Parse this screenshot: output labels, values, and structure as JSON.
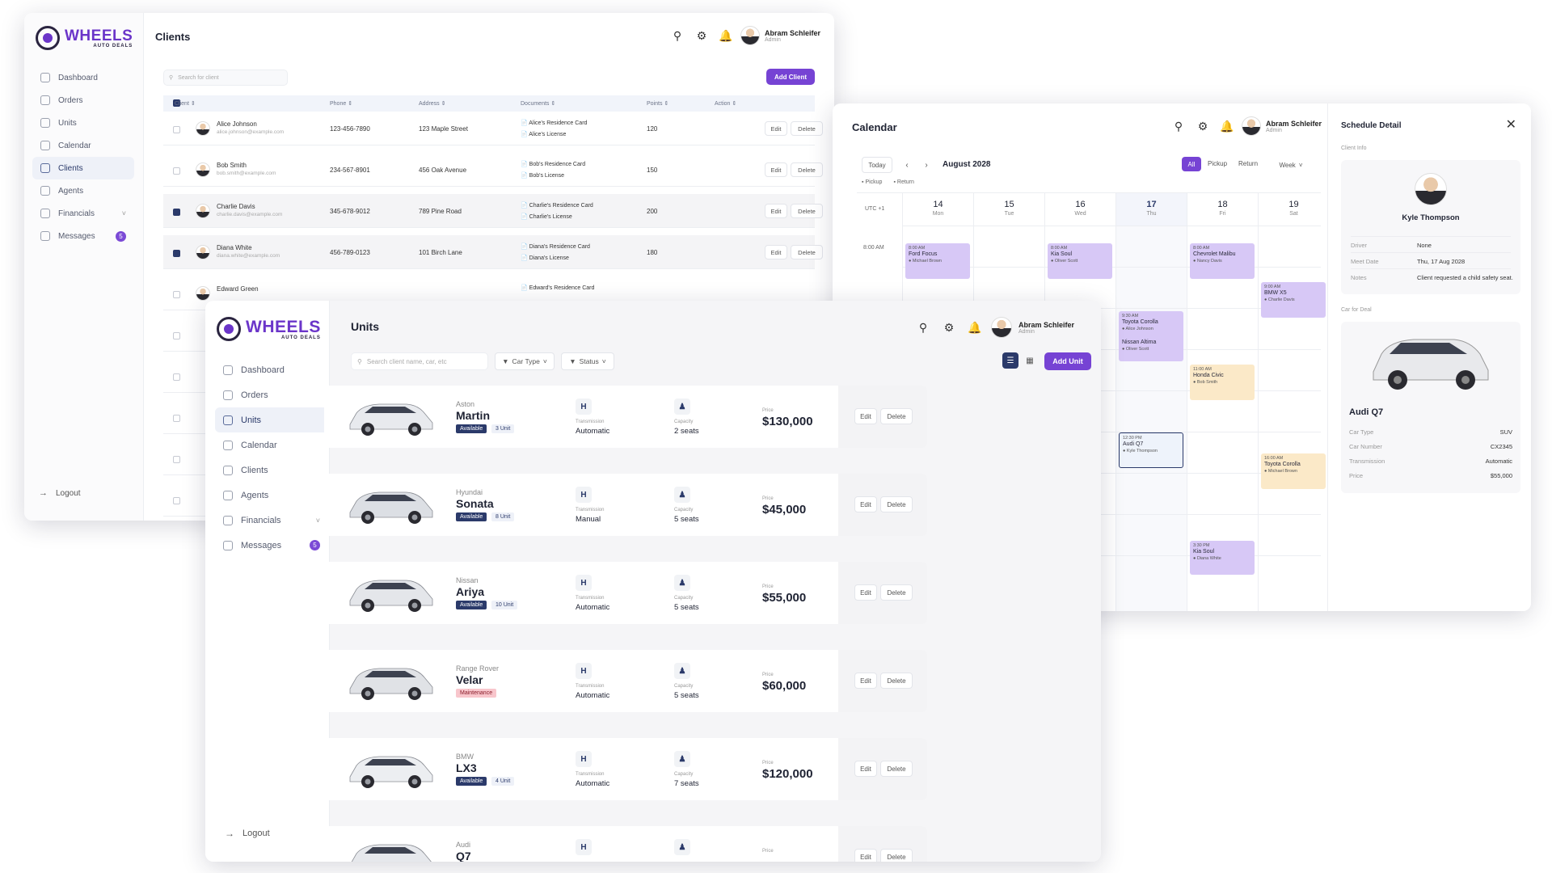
{
  "brand": {
    "name": "WHEELS",
    "tagline": "AUTO DEALS"
  },
  "user": {
    "name": "Abram Schleifer",
    "role": "Admin"
  },
  "nav": [
    {
      "label": "Dashboard",
      "icon": "dashboard-icon"
    },
    {
      "label": "Orders",
      "icon": "orders-icon"
    },
    {
      "label": "Units",
      "icon": "car-icon"
    },
    {
      "label": "Calendar",
      "icon": "calendar-icon"
    },
    {
      "label": "Clients",
      "icon": "clients-icon"
    },
    {
      "label": "Agents",
      "icon": "agents-icon"
    },
    {
      "label": "Financials",
      "icon": "financials-icon"
    },
    {
      "label": "Messages",
      "icon": "messages-icon",
      "badge": "5"
    }
  ],
  "logout": "Logout",
  "clients": {
    "title": "Clients",
    "search_placeholder": "Search for client",
    "add_button": "Add Client",
    "columns": [
      "Client",
      "Phone",
      "Address",
      "Documents",
      "Points",
      "Action"
    ],
    "rows": [
      {
        "name": "Alice Johnson",
        "email": "alice.johnson@example.com",
        "phone": "123-456-7890",
        "address": "123 Maple Street",
        "doc1": "Alice's Residence Card",
        "doc2": "Alice's License",
        "points": "120",
        "checked": false
      },
      {
        "name": "Bob Smith",
        "email": "bob.smith@example.com",
        "phone": "234-567-8901",
        "address": "456 Oak Avenue",
        "doc1": "Bob's Residence Card",
        "doc2": "Bob's License",
        "points": "150",
        "checked": false
      },
      {
        "name": "Charlie Davis",
        "email": "charlie.davis@example.com",
        "phone": "345-678-9012",
        "address": "789 Pine Road",
        "doc1": "Charlie's Residence Card",
        "doc2": "Charlie's License",
        "points": "200",
        "checked": true
      },
      {
        "name": "Diana White",
        "email": "diana.white@example.com",
        "phone": "456-789-0123",
        "address": "101 Birch Lane",
        "doc1": "Diana's Residence Card",
        "doc2": "Diana's License",
        "points": "180",
        "checked": true
      },
      {
        "name": "Edward Green",
        "email": "",
        "phone": "",
        "address": "",
        "doc1": "Edward's Residence Card",
        "doc2": "",
        "points": "",
        "checked": false
      }
    ],
    "edit": "Edit",
    "delete": "Delete"
  },
  "calendar": {
    "title": "Calendar",
    "today": "Today",
    "month": "August 2028",
    "filters": [
      "All",
      "Pickup",
      "Return"
    ],
    "view": "Week",
    "legend": [
      "Pickup",
      "Return"
    ],
    "tz": "UTC +1",
    "time_label": "8:00 AM",
    "days": [
      {
        "num": "14",
        "name": "Mon"
      },
      {
        "num": "15",
        "name": "Tue"
      },
      {
        "num": "16",
        "name": "Wed"
      },
      {
        "num": "17",
        "name": "Thu"
      },
      {
        "num": "18",
        "name": "Fri"
      },
      {
        "num": "19",
        "name": "Sat"
      }
    ],
    "events": [
      {
        "time": "8:00 AM",
        "car": "Ford Focus",
        "who": "Michael Brown"
      },
      {
        "time": "8:00 AM",
        "car": "Kia Soul",
        "who": "Oliver Scott"
      },
      {
        "time": "8:00 AM",
        "car": "Chevrolet Malibu",
        "who": "Nancy Davis"
      },
      {
        "time": "9:00 AM",
        "car": "BMW X5",
        "who": "Charlie Davis"
      },
      {
        "time": "9:30 AM",
        "car": "Toyota Corolla",
        "who": "Alice Johnson"
      },
      {
        "time": "",
        "car": "Nissan Altima",
        "who": "Oliver Scott"
      },
      {
        "time": "11:00 AM",
        "car": "Honda Civic",
        "who": "Bob Smith"
      },
      {
        "time": "12:30 PM",
        "car": "Audi Q7",
        "who": "Kyle Thompson"
      },
      {
        "time": "16:00 AM",
        "car": "Toyota Corolla",
        "who": "Michael Brown"
      },
      {
        "time": "3:30 PM",
        "car": "Kia Soul",
        "who": "Diana White"
      }
    ]
  },
  "schedule": {
    "title": "Schedule Detail",
    "client_info": "Client Info",
    "client_name": "Kyle Thompson",
    "fields": [
      {
        "label": "Driver",
        "value": "None"
      },
      {
        "label": "Meet Date",
        "value": "Thu, 17 Aug 2028"
      },
      {
        "label": "Notes",
        "value": "Client requested a child safety seat."
      }
    ],
    "car_for_deal": "Car for Deal",
    "car_name": "Audi Q7",
    "car_fields": [
      {
        "label": "Car Type",
        "value": "SUV"
      },
      {
        "label": "Car Number",
        "value": "CX2345"
      },
      {
        "label": "Transmission",
        "value": "Automatic"
      },
      {
        "label": "Price",
        "value": "$55,000"
      }
    ]
  },
  "units": {
    "title": "Units",
    "search_placeholder": "Search client name, car, etc",
    "filter_type": "Car Type",
    "filter_status": "Status",
    "add_button": "Add Unit",
    "transmission_label": "Transmission",
    "capacity_label": "Capacity",
    "price_label": "Price",
    "edit": "Edit",
    "delete": "Delete",
    "items": [
      {
        "brand": "Aston",
        "model": "Martin",
        "status": "Available",
        "qty": "3 Unit",
        "transmission": "Automatic",
        "capacity": "2 seats",
        "price": "$130,000",
        "color": "#e8eaee"
      },
      {
        "brand": "Hyundai",
        "model": "Sonata",
        "status": "Available",
        "qty": "8 Unit",
        "transmission": "Manual",
        "capacity": "5 seats",
        "price": "$45,000",
        "color": "#dcdfe4"
      },
      {
        "brand": "Nissan",
        "model": "Ariya",
        "status": "Available",
        "qty": "10 Unit",
        "transmission": "Automatic",
        "capacity": "5 seats",
        "price": "$55,000",
        "color": "#e4e6ea"
      },
      {
        "brand": "Range Rover",
        "model": "Velar",
        "status": "Maintenance",
        "qty": "",
        "transmission": "Automatic",
        "capacity": "5 seats",
        "price": "$60,000",
        "color": "#e0e2e6"
      },
      {
        "brand": "BMW",
        "model": "LX3",
        "status": "Available",
        "qty": "4 Unit",
        "transmission": "Automatic",
        "capacity": "7 seats",
        "price": "$120,000",
        "color": "#eceef1"
      },
      {
        "brand": "Audi",
        "model": "Q7",
        "status": "",
        "qty": "",
        "transmission": "",
        "capacity": "",
        "price": "",
        "color": "#e6e8ec"
      }
    ]
  }
}
